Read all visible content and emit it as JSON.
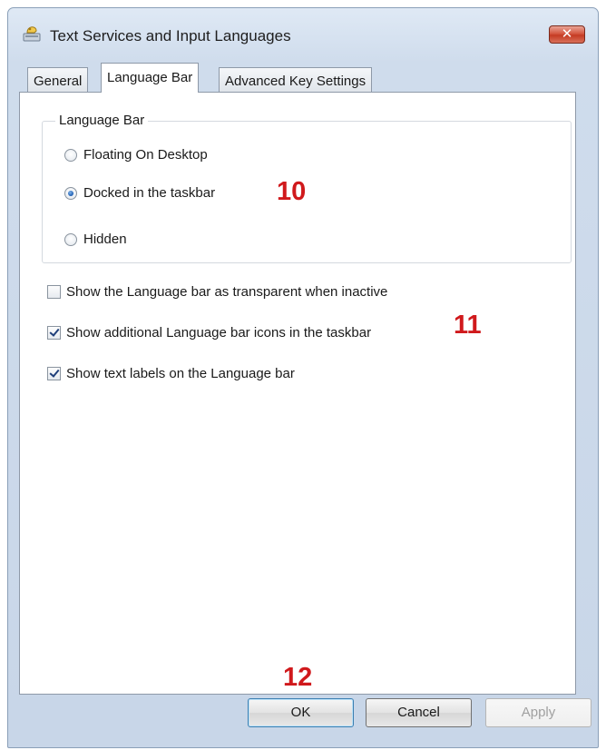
{
  "window": {
    "title": "Text Services and Input Languages",
    "close_glyph": "✕"
  },
  "tabs": [
    {
      "label": "General",
      "active": false
    },
    {
      "label": "Language Bar",
      "active": true
    },
    {
      "label": "Advanced Key Settings",
      "active": false
    }
  ],
  "language_bar_group": {
    "title": "Language Bar",
    "options": [
      {
        "label": "Floating On Desktop",
        "selected": false
      },
      {
        "label": "Docked in the taskbar",
        "selected": true
      },
      {
        "label": "Hidden",
        "selected": false
      }
    ]
  },
  "checkboxes": [
    {
      "label": "Show the Language bar as transparent when inactive",
      "checked": false
    },
    {
      "label": "Show additional Language bar icons in the taskbar",
      "checked": true
    },
    {
      "label": "Show text labels on the Language bar",
      "checked": true
    }
  ],
  "annotations": [
    "10",
    "11",
    "12"
  ],
  "buttons": {
    "ok": "OK",
    "cancel": "Cancel",
    "apply": "Apply",
    "apply_enabled": false
  },
  "colors": {
    "annotation": "#d0191c",
    "accent": "#1b5bb0"
  },
  "icons": {
    "app": "text-services-icon",
    "close": "close-icon"
  }
}
